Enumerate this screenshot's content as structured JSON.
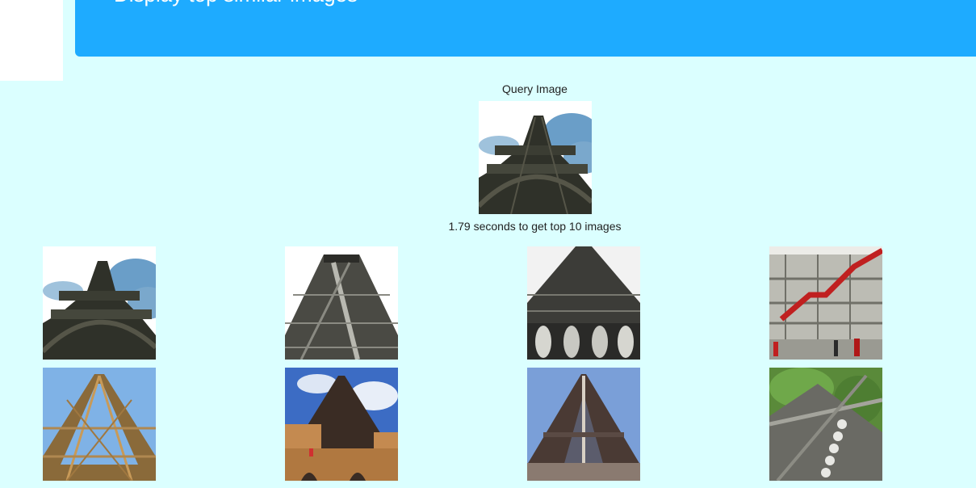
{
  "banner": {
    "title": "Display top similar images"
  },
  "query": {
    "label": "Query Image",
    "image_icon": "eiffel-tower-photo"
  },
  "results": {
    "timing_text": "1.79 seconds to get top 10 images",
    "items": [
      {
        "icon": "eiffel-tower-photo"
      },
      {
        "icon": "eiffel-tower-photo"
      },
      {
        "icon": "eiffel-tower-photo"
      },
      {
        "icon": "pompidou-centre-photo"
      },
      {
        "icon": "eiffel-tower-photo"
      },
      {
        "icon": "eiffel-tower-photo"
      },
      {
        "icon": "eiffel-tower-photo"
      },
      {
        "icon": "eiffel-tower-photo"
      }
    ]
  },
  "colors": {
    "background": "#dbffff",
    "banner": "#1eabff",
    "sidebar": "#ffffff"
  }
}
